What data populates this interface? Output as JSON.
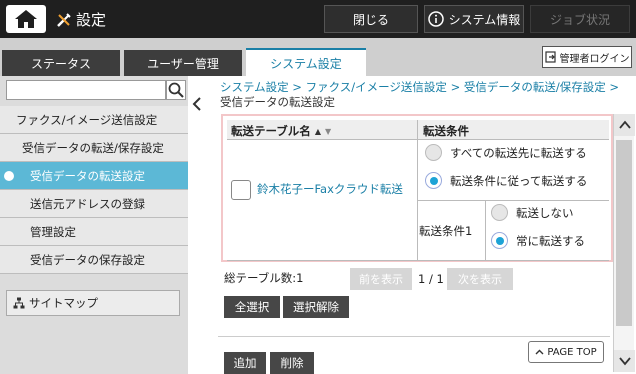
{
  "header": {
    "title": "設定",
    "close_label": "閉じる",
    "sysinfo_label": "システム情報",
    "job_label": "ジョブ状況"
  },
  "tabs": [
    {
      "label": "ステータス"
    },
    {
      "label": "ユーザー管理"
    },
    {
      "label": "システム設定",
      "active": true
    }
  ],
  "admin_login_label": "管理者ログイン",
  "sidebar": {
    "search_value": "",
    "items": [
      {
        "label": "ファクス/イメージ送信設定"
      },
      {
        "label": "受信データの転送/保存設定"
      },
      {
        "label": "受信データの転送設定",
        "selected": true
      },
      {
        "label": "送信元アドレスの登録"
      },
      {
        "label": "管理設定"
      },
      {
        "label": "受信データの保存設定"
      }
    ],
    "sitemap_label": "サイトマップ"
  },
  "breadcrumb": {
    "items": [
      "システム設定 >",
      "ファクス/イメージ送信設定 >",
      "受信データの転送/保存設定 >"
    ],
    "current": "受信データの転送設定"
  },
  "table": {
    "col_name": "転送テーブル名",
    "col_cond": "転送条件",
    "row": {
      "name": "鈴木花子ーFaxクラウド転送",
      "checked": false,
      "options": [
        {
          "label": "すべての転送先に転送する",
          "selected": false
        },
        {
          "label": "転送条件に従って転送する",
          "selected": true
        }
      ],
      "condition_label": "転送条件1",
      "condition_options": [
        {
          "label": "転送しない",
          "selected": false
        },
        {
          "label": "常に転送する",
          "selected": true
        }
      ]
    }
  },
  "pagination": {
    "total": "総テーブル数:1",
    "prev_label": "前を表示",
    "page": "1 / 1",
    "next_label": "次を表示"
  },
  "actions": {
    "select_all": "全選択",
    "deselect": "選択解除",
    "add": "追加",
    "delete": "削除",
    "page_top": "PAGE TOP"
  },
  "colors": {
    "accent": "#1a7fa6",
    "selected_nav": "#5cb8d6",
    "radio_on": "#1da3d6"
  }
}
